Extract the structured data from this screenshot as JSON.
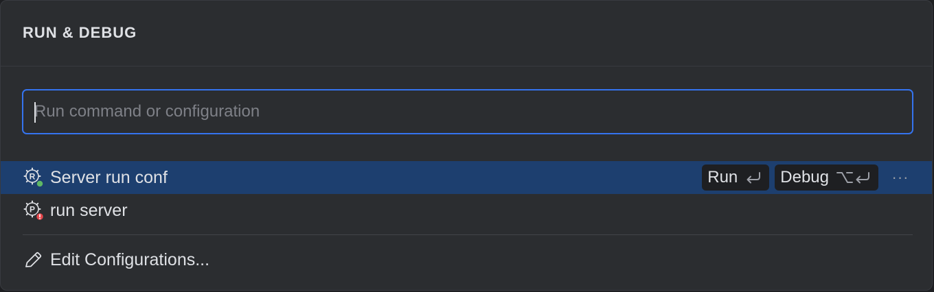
{
  "popup": {
    "title": "RUN & DEBUG",
    "search": {
      "placeholder": "Run command or configuration",
      "value": ""
    },
    "items": [
      {
        "label": "Server run conf",
        "icon": "rust-run-config-icon",
        "status": "running",
        "status_color": "#5fb865",
        "selected": true,
        "actions": {
          "run_label": "Run",
          "run_shortcut": "↩",
          "debug_label": "Debug",
          "debug_shortcut": "⌥↩",
          "more_label": "···"
        }
      },
      {
        "label": "run server",
        "icon": "python-run-config-icon",
        "status": "error",
        "status_color": "#e5484d",
        "selected": false
      }
    ],
    "footer": {
      "label": "Edit Configurations...",
      "icon": "pencil-icon"
    }
  },
  "colors": {
    "accent": "#3574f0",
    "selection": "#1d3f6f",
    "background": "#2b2d30"
  }
}
